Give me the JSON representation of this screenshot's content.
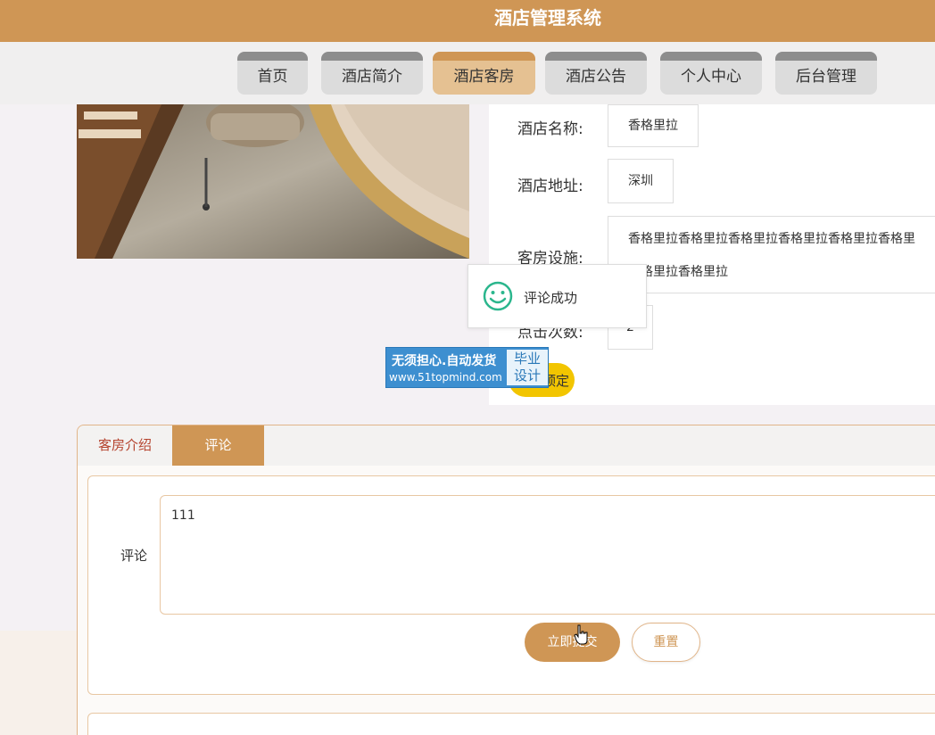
{
  "header": {
    "title": "酒店管理系统"
  },
  "nav": {
    "items": [
      {
        "label": "首页",
        "active": false
      },
      {
        "label": "酒店简介",
        "active": false
      },
      {
        "label": "酒店客房",
        "active": true
      },
      {
        "label": "酒店公告",
        "active": false
      },
      {
        "label": "个人中心",
        "active": false
      },
      {
        "label": "后台管理",
        "active": false
      }
    ]
  },
  "room_info": {
    "hotel_name_label": "酒店名称:",
    "hotel_name_value": "香格里拉",
    "address_label": "酒店地址:",
    "address_value": "深圳",
    "facilities_label": "客房设施:",
    "facilities_line1": "香格里拉香格里拉香格里拉香格里拉香格里拉香格里",
    "facilities_line2": "香格里拉香格里拉",
    "clicks_label": "点击次数:",
    "clicks_value": "2",
    "reserve_button": "预定"
  },
  "toast": {
    "message": "评论成功",
    "icon": "smile-icon"
  },
  "watermark": {
    "line1": "无须担心.自动发货",
    "line2": "www.51topmind.com",
    "badge_line1": "毕业",
    "badge_line2": "设计"
  },
  "tabs": [
    {
      "label": "客房介绍",
      "active": false
    },
    {
      "label": "评论",
      "active": true
    }
  ],
  "comment_form": {
    "label": "评论",
    "value": "111",
    "submit_label": "立即提交",
    "reset_label": "重置"
  },
  "colors": {
    "brand": "#cf9655",
    "nav_active": "#e5c192",
    "reserve": "#f2c500",
    "toast_icon": "#2bb68d"
  }
}
